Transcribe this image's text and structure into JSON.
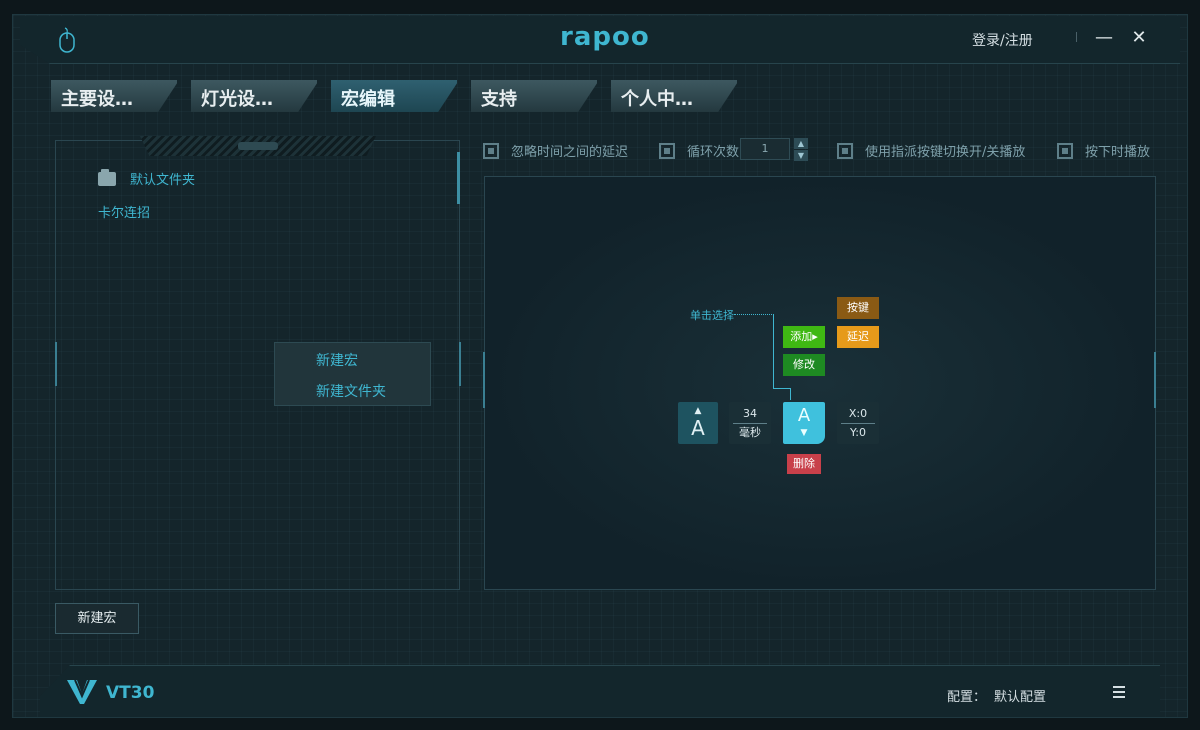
{
  "app": {
    "logo_text": "rapoo",
    "login_label": "登录/注册",
    "minimize_label": "—",
    "close_label": "✕"
  },
  "tabs": [
    {
      "label": "主要设…",
      "active": false
    },
    {
      "label": "灯光设…",
      "active": false
    },
    {
      "label": "宏编辑",
      "active": true
    },
    {
      "label": "支持",
      "active": false
    },
    {
      "label": "个人中…",
      "active": false
    }
  ],
  "macro_list": {
    "folder_label": "默认文件夹",
    "items": [
      "卡尔连招"
    ]
  },
  "context_menu": {
    "items": [
      "新建宏",
      "新建文件夹"
    ]
  },
  "new_macro_button": "新建宏",
  "options": {
    "ignore_delay_label": "忽略时间之间的延迟",
    "loop_count_label": "循环次数",
    "loop_count_value": "1",
    "toggle_play_label": "使用指派按键切换开/关播放",
    "hold_play_label": "按下时播放"
  },
  "editor": {
    "hint_label": "单击选择",
    "add_button": "添加",
    "add_arrow": "▸",
    "modify_button": "修改",
    "key_button": "按键",
    "delay_button": "延迟",
    "delete_button": "删除",
    "events": {
      "key_down": {
        "letter": "A",
        "arrow": "▲"
      },
      "delay": {
        "value": "34",
        "unit": "毫秒"
      },
      "key_up": {
        "letter": "A",
        "arrow": "▼"
      },
      "coords": {
        "x": "X:0",
        "y": "Y:0"
      }
    }
  },
  "footer": {
    "model": "VT30",
    "config_label": "配置：",
    "config_value": "默认配置"
  },
  "colors": {
    "accent": "#3fb6d0",
    "add_green": "#3fb813",
    "modify_green": "#1e8a22",
    "key_brown": "#8a5a14",
    "delay_orange": "#e69a1a",
    "delete_red": "#c8404a"
  }
}
